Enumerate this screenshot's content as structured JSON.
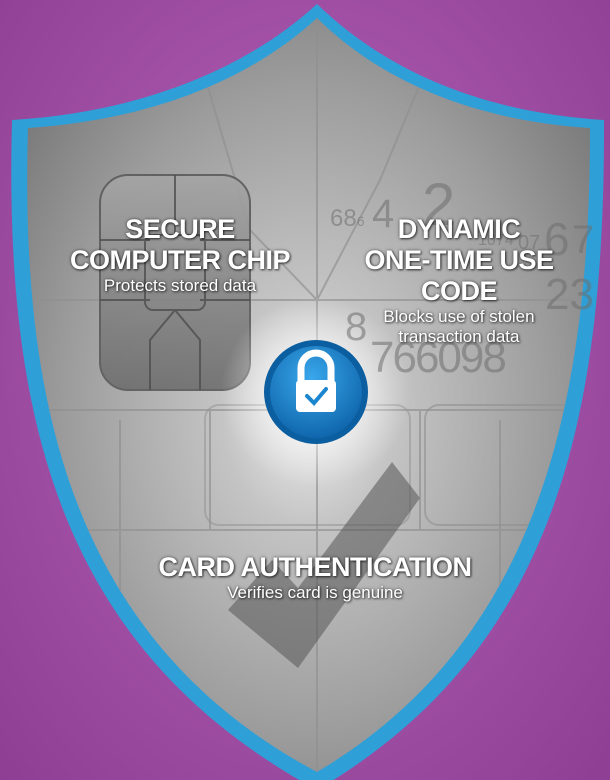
{
  "colors": {
    "background": "#a453a8",
    "shield_border": "#2f9fd8",
    "shield_fill": "#a8a8a8",
    "lock_badge": "#1b86cf"
  },
  "features": {
    "chip": {
      "title_line1": "SECURE",
      "title_line2": "COMPUTER CHIP",
      "description": "Protects stored data"
    },
    "code": {
      "title_line1": "DYNAMIC",
      "title_line2": "ONE-TIME USE CODE",
      "description_line1": "Blocks use of stolen",
      "description_line2": "transaction data"
    },
    "auth": {
      "title": "CARD AUTHENTICATION",
      "description": "Verifies card is genuine"
    }
  },
  "icons": {
    "center": "padlock-check-icon",
    "chip": "emv-chip-icon",
    "check": "checkmark-icon"
  }
}
